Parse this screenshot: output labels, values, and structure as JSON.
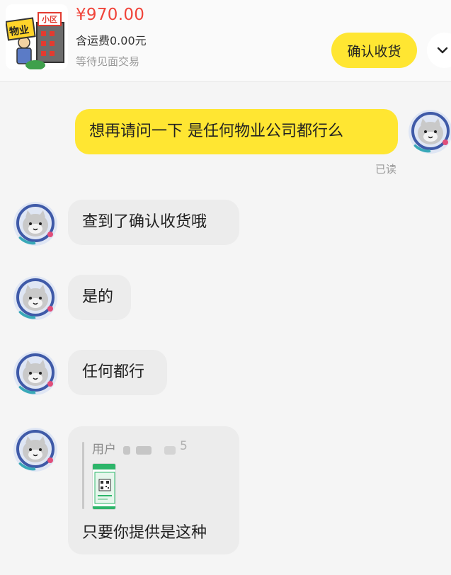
{
  "header": {
    "product_thumb_icon": "property-management-cartoon",
    "thumb_sign_left": "物业",
    "thumb_sign_right": "小区",
    "price": "¥970.00",
    "shipping": "含运费0.00元",
    "trade_status": "等待见面交易",
    "confirm_button": "确认收货",
    "expand_icon": "chevron-down-icon"
  },
  "messages": [
    {
      "from": "me",
      "text": "想再请问一下 是任何物业公司都行么",
      "status": "已读"
    },
    {
      "from": "them",
      "text": "查到了确认收货哦"
    },
    {
      "from": "them",
      "text": "是的"
    },
    {
      "from": "them",
      "text": "任何都行"
    },
    {
      "from": "them",
      "quote": {
        "user": "用户",
        "user_tail": "5",
        "preview_icon": "qr-code-screenshot"
      },
      "text": "只要你提供是这种"
    }
  ],
  "colors": {
    "accent_yellow": "#ffe632",
    "price_red": "#f0443a",
    "bubble_gray": "#ececec",
    "avatar_ring": "#3f5aa8"
  },
  "avatar_icon": "cat-astronaut-avatar-icon"
}
